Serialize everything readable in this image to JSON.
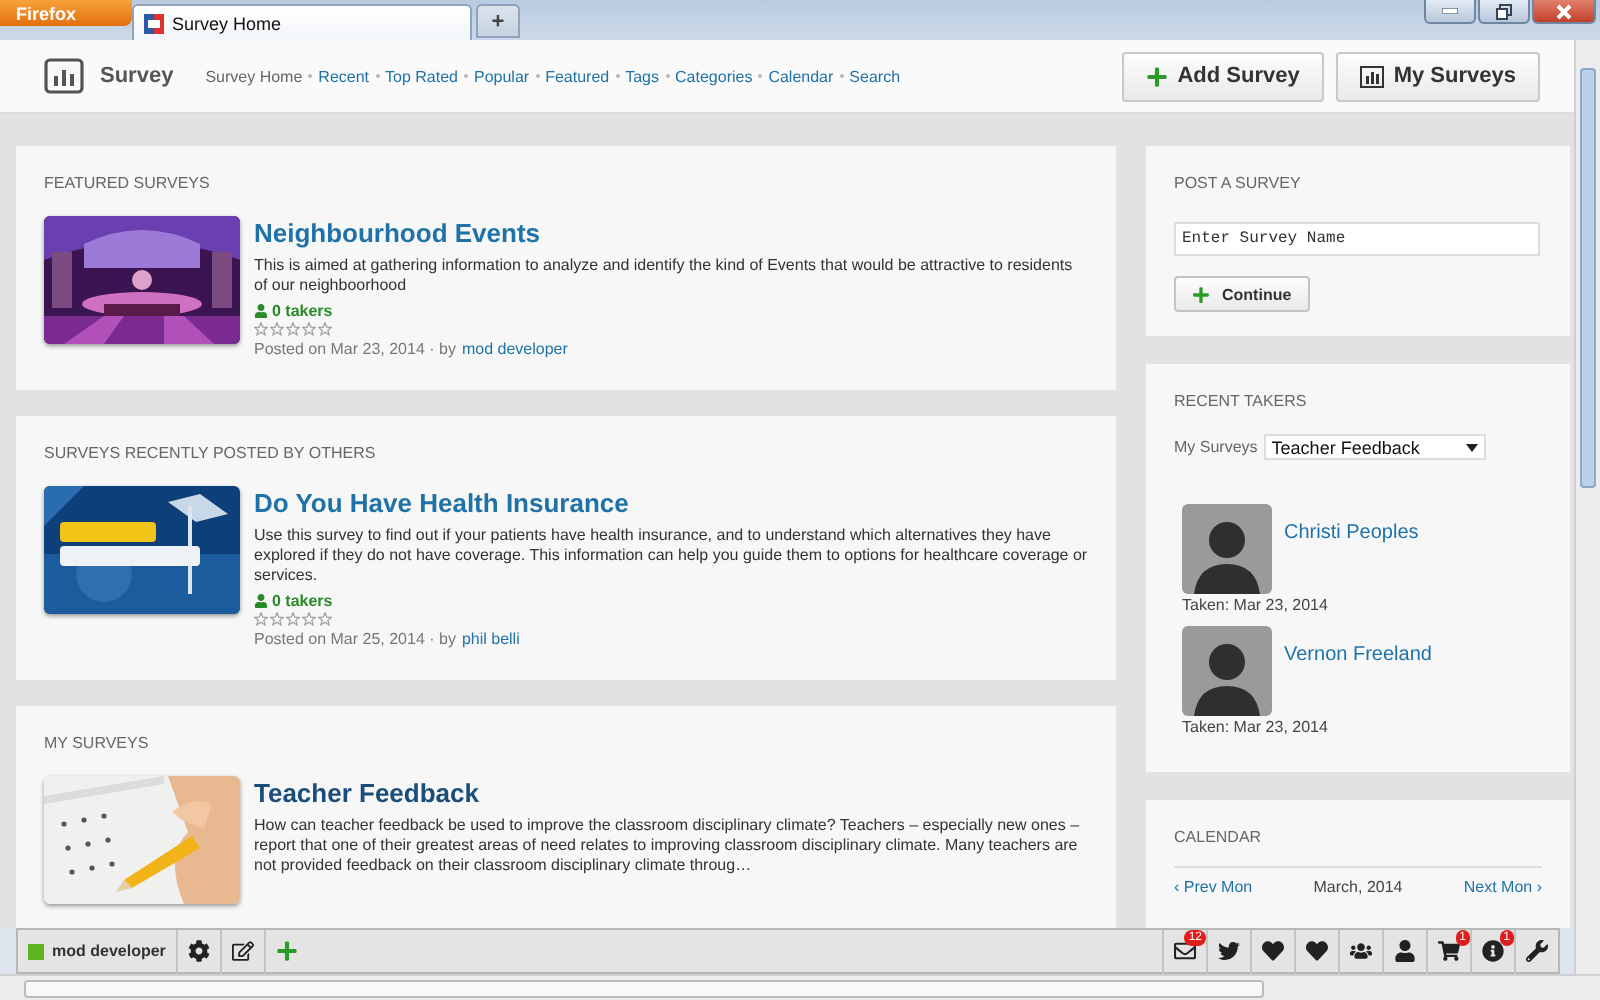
{
  "browser": {
    "menu_button": "Firefox",
    "tab": {
      "title": "Survey Home"
    },
    "new_tab": "+"
  },
  "header": {
    "site_name": "Survey",
    "nav": [
      {
        "label": "Survey Home",
        "selected": true
      },
      {
        "label": "Recent",
        "selected": false
      },
      {
        "label": "Top Rated",
        "selected": false
      },
      {
        "label": "Popular",
        "selected": false
      },
      {
        "label": "Featured",
        "selected": false
      },
      {
        "label": "Tags",
        "selected": false
      },
      {
        "label": "Categories",
        "selected": false
      },
      {
        "label": "Calendar",
        "selected": false
      },
      {
        "label": "Search",
        "selected": false
      }
    ],
    "buttons": [
      {
        "label": "Add Survey",
        "kind": "add"
      },
      {
        "label": "My Surveys",
        "kind": "chart"
      }
    ]
  },
  "sections": [
    {
      "heading": "FEATURED SURVEYS",
      "surveys": [
        {
          "title": "Neighbourhood Events",
          "description": "This is aimed at gathering information to analyze and identify the kind of Events that would be attractive to residents of our neighboorhood",
          "takers": "0 takers",
          "stars": 0,
          "posted": "Posted on Mar 23, 2014 · by",
          "author": "mod developer"
        }
      ]
    },
    {
      "heading": "SURVEYS RECENTLY POSTED BY OTHERS",
      "surveys": [
        {
          "title": "Do You Have Health Insurance",
          "description": "Use this survey to find out if your patients have health insurance, and to understand which alternatives they have explored if they do not have coverage. This information can help you guide them to options for healthcare coverage or services.",
          "takers": "0 takers",
          "stars": 0,
          "posted": "Posted on Mar 25, 2014 · by",
          "author": "phil belli"
        }
      ]
    },
    {
      "heading": "MY SURVEYS",
      "surveys": [
        {
          "title": "Teacher Feedback",
          "description": "How can teacher feedback be used to improve the classroom disciplinary climate? Teachers – especially new ones – report that one of their greatest areas of need relates to improving classroom disciplinary climate. Many teachers are not provided feedback on their classroom disciplinary climate throug…"
        }
      ]
    }
  ],
  "sidebar": {
    "post_survey": {
      "heading": "POST A SURVEY",
      "placeholder": "Enter Survey Name",
      "button": "Continue"
    },
    "recent_takers": {
      "heading": "RECENT TAKERS",
      "filter_label": "My Surveys",
      "filter_value": "Teacher Feedback",
      "takers": [
        {
          "name": "Christi Peoples",
          "taken": "Taken: Mar 23, 2014"
        },
        {
          "name": "Vernon Freeland",
          "taken": "Taken: Mar 23, 2014"
        }
      ]
    },
    "calendar": {
      "heading": "CALENDAR",
      "prev": "‹ Prev Mon",
      "month": "March, 2014",
      "next": "Next Mon ›"
    }
  },
  "toolbar": {
    "user": "mod developer",
    "tools": [
      {
        "kind": "gear"
      },
      {
        "kind": "edit"
      },
      {
        "kind": "plus"
      }
    ],
    "icons": [
      {
        "kind": "mail",
        "badge": "12"
      },
      {
        "kind": "bird"
      },
      {
        "kind": "heart"
      },
      {
        "kind": "heart"
      },
      {
        "kind": "group"
      },
      {
        "kind": "user"
      },
      {
        "kind": "cart",
        "badge": "1"
      },
      {
        "kind": "info",
        "badge": "1"
      },
      {
        "kind": "wrench"
      }
    ]
  }
}
